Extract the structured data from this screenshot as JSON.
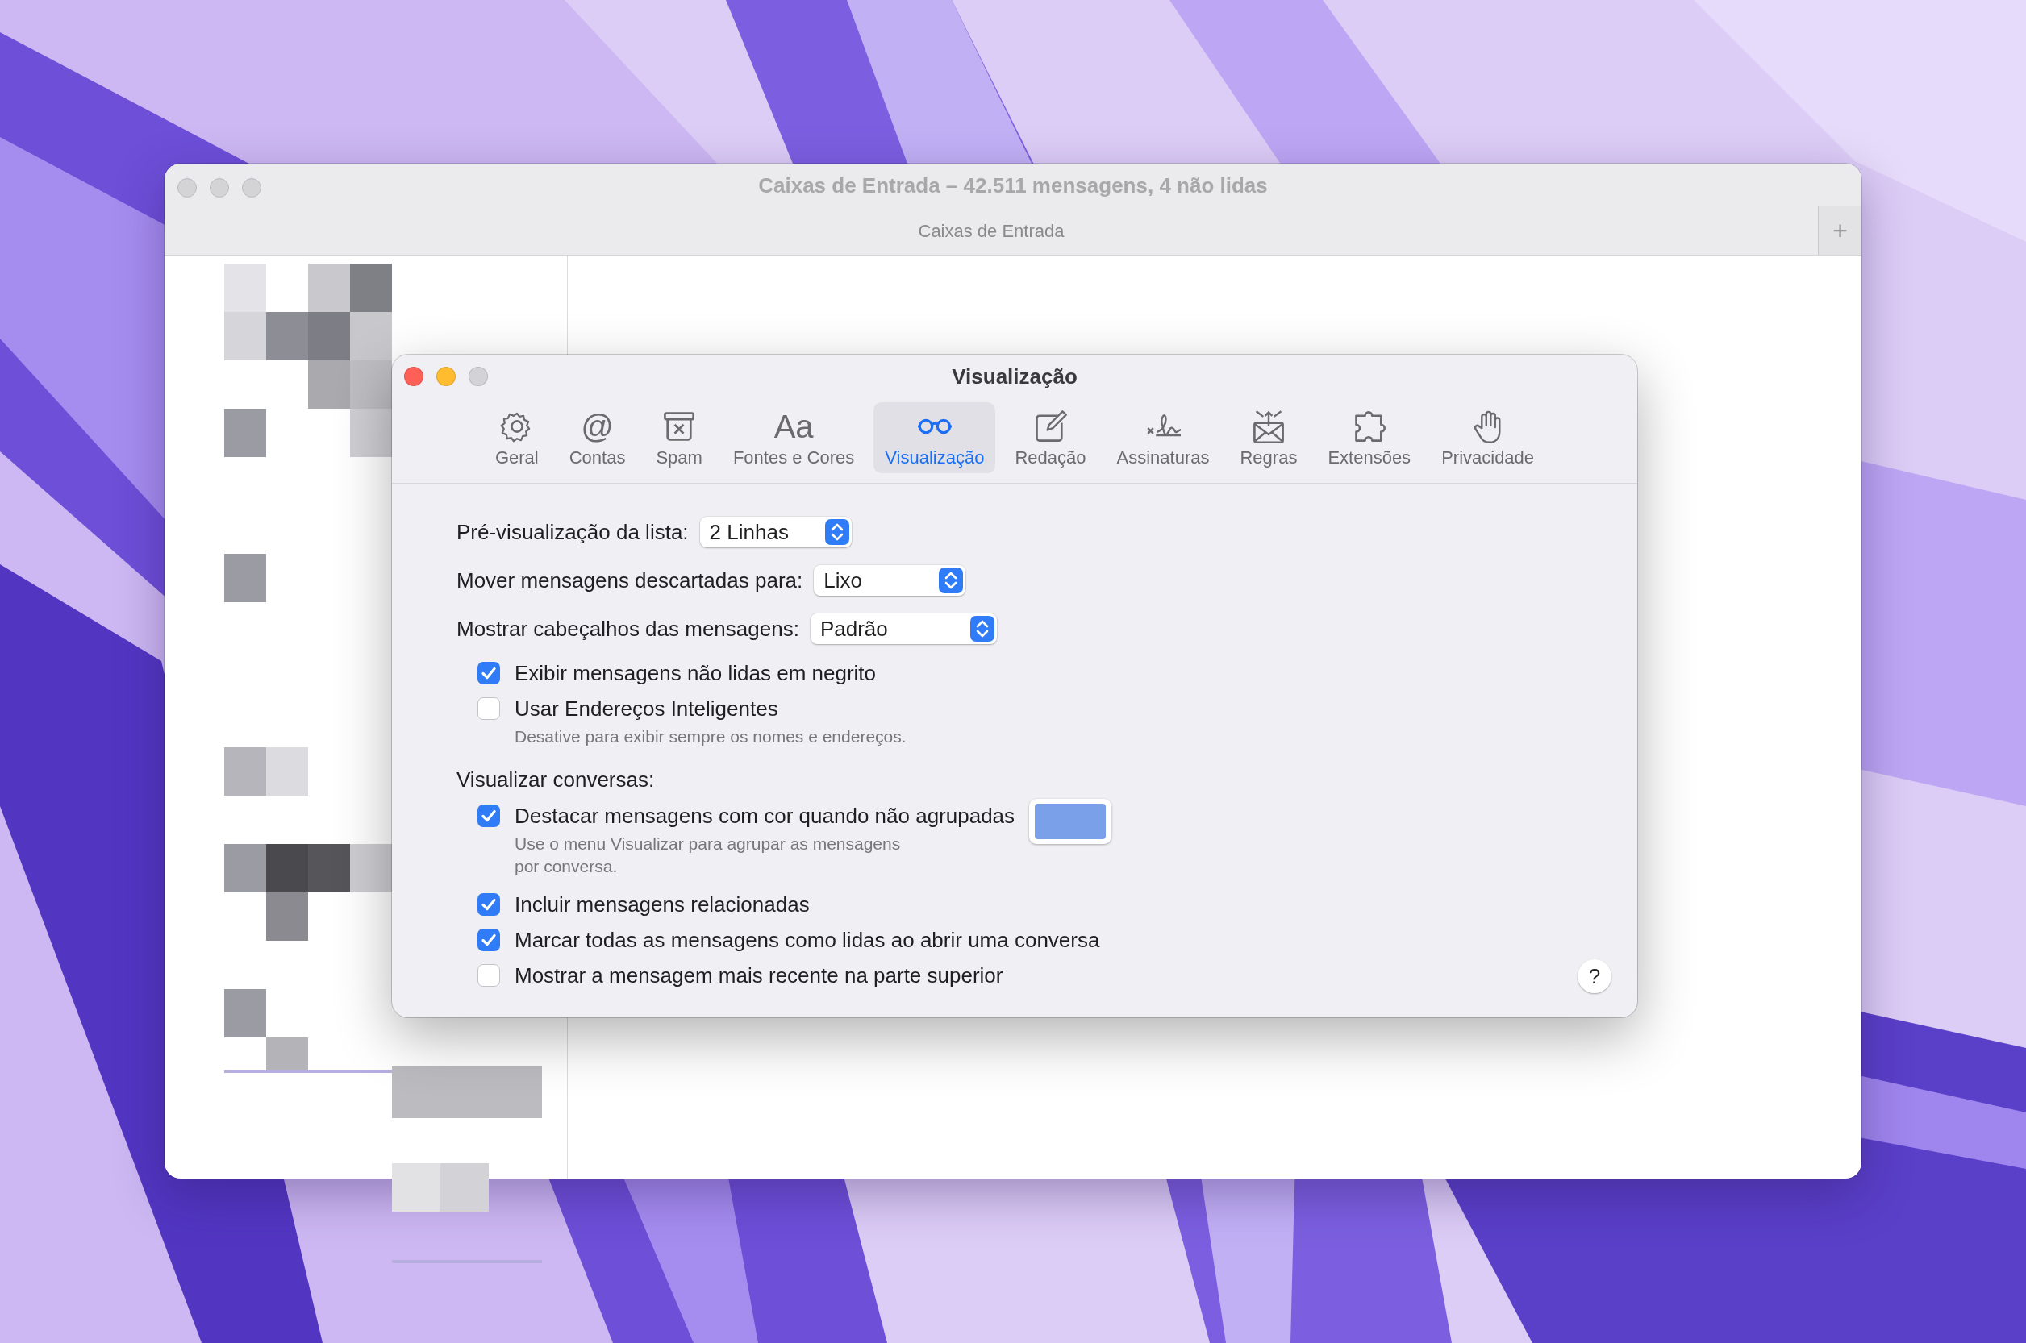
{
  "main_window": {
    "title": "Caixas de Entrada – 42.511 mensagens, 4 não lidas",
    "tab": "Caixas de Entrada",
    "new_tab_button": "+"
  },
  "preferences": {
    "title": "Visualização",
    "tabs": [
      {
        "label": "Geral",
        "selected": false
      },
      {
        "label": "Contas",
        "glyph": "@",
        "selected": false
      },
      {
        "label": "Spam",
        "selected": false
      },
      {
        "label": "Fontes e Cores",
        "glyph": "Aa",
        "selected": false
      },
      {
        "label": "Visualização",
        "selected": true
      },
      {
        "label": "Redação",
        "selected": false
      },
      {
        "label": "Assinaturas",
        "selected": false
      },
      {
        "label": "Regras",
        "selected": false
      },
      {
        "label": "Extensões",
        "selected": false
      },
      {
        "label": "Privacidade",
        "selected": false
      }
    ],
    "popups": [
      {
        "label": "Pré-visualização da lista:",
        "value": "2 Linhas"
      },
      {
        "label": "Mover mensagens descartadas para:",
        "value": "Lixo"
      },
      {
        "label": "Mostrar cabeçalhos das mensagens:",
        "value": "Padrão"
      }
    ],
    "options": [
      {
        "kind": "checkbox",
        "label": "Exibir mensagens não lidas em negrito",
        "checked": true
      },
      {
        "kind": "checkbox",
        "label": "Usar Endereços Inteligentes",
        "checked": false,
        "hint": "Desative para exibir sempre os nomes e endereços."
      },
      {
        "kind": "heading",
        "label": "Visualizar conversas:"
      },
      {
        "kind": "checkbox",
        "label": "Destacar mensagens com cor quando não agrupadas",
        "checked": true,
        "hint": "Use o menu Visualizar para agrupar as mensagens\npor conversa.",
        "color": "#7aa0ea"
      },
      {
        "kind": "checkbox",
        "label": "Incluir mensagens relacionadas",
        "checked": true
      },
      {
        "kind": "checkbox",
        "label": "Marcar todas as mensagens como lidas ao abrir uma conversa",
        "checked": true
      },
      {
        "kind": "checkbox",
        "label": "Mostrar a mensagem mais recente na parte superior",
        "checked": false
      }
    ],
    "help_button": "?"
  }
}
